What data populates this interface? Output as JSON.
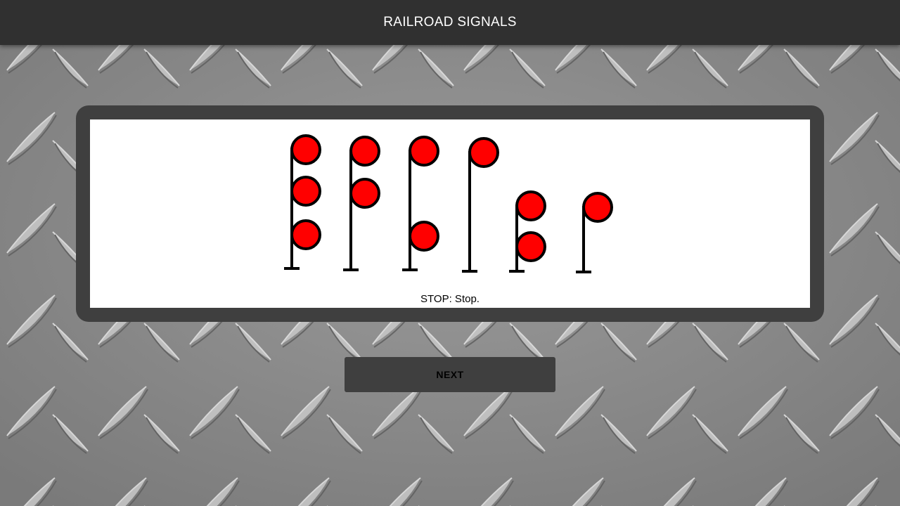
{
  "header": {
    "title": "RAILROAD SIGNALS"
  },
  "signal_panel": {
    "caption": "STOP: Stop.",
    "signals": [
      {
        "name": "signal-three-heads",
        "aspect": [
          "red",
          "red",
          "red"
        ]
      },
      {
        "name": "signal-two-upper-heads",
        "aspect": [
          "red",
          "red"
        ]
      },
      {
        "name": "signal-top-and-bottom-heads",
        "aspect": [
          "red",
          "red"
        ]
      },
      {
        "name": "signal-single-head",
        "aspect": [
          "red"
        ]
      },
      {
        "name": "signal-dwarf-two-heads",
        "aspect": [
          "red",
          "red"
        ]
      },
      {
        "name": "signal-dwarf-single-head",
        "aspect": [
          "red"
        ]
      }
    ],
    "lamp_color": "#ff0000",
    "mast_color": "#000000"
  },
  "actions": {
    "next_label": "NEXT"
  },
  "colors": {
    "header_bg": "#303030",
    "frame_bg": "#3f3f3f",
    "button_bg": "#3f3f3f"
  }
}
